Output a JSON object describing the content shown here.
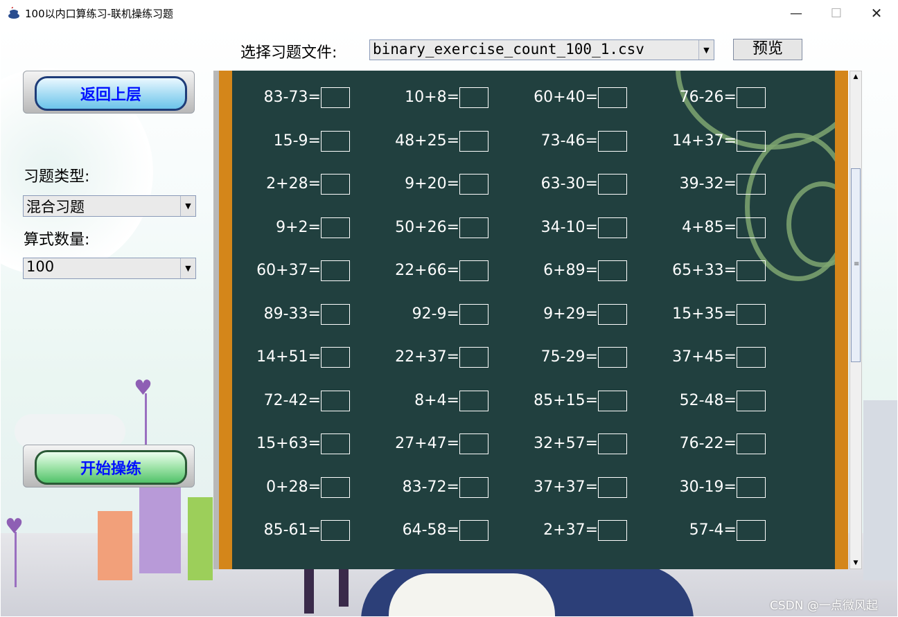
{
  "window": {
    "title": "100以内口算练习-联机操练习题",
    "controls": {
      "minimize": "—",
      "maximize": "☐",
      "close": "✕"
    }
  },
  "toolbar": {
    "file_label": "选择习题文件:",
    "file_value": "binary_exercise_count_100_1.csv",
    "preview_label": "预览"
  },
  "sidebar": {
    "back_label": "返回上层",
    "type_label": "习题类型:",
    "type_value": "混合习题",
    "count_label": "算式数量:",
    "count_value": "100",
    "start_label": "开始操练"
  },
  "exercises": [
    [
      "83-73=",
      "10+8=",
      "60+40=",
      "76-26="
    ],
    [
      "15-9=",
      "48+25=",
      "73-46=",
      "14+37="
    ],
    [
      "2+28=",
      "9+20=",
      "63-30=",
      "39-32="
    ],
    [
      "9+2=",
      "50+26=",
      "34-10=",
      "4+85="
    ],
    [
      "60+37=",
      "22+66=",
      "6+89=",
      "65+33="
    ],
    [
      "89-33=",
      "92-9=",
      "9+29=",
      "15+35="
    ],
    [
      "14+51=",
      "22+37=",
      "75-29=",
      "37+45="
    ],
    [
      "72-42=",
      "8+4=",
      "85+15=",
      "52-48="
    ],
    [
      "15+63=",
      "27+47=",
      "32+57=",
      "76-22="
    ],
    [
      "0+28=",
      "83-72=",
      "37+37=",
      "30-19="
    ],
    [
      "85-61=",
      "64-58=",
      "2+37=",
      "57-4="
    ]
  ],
  "watermark": "CSDN @一点微风起"
}
